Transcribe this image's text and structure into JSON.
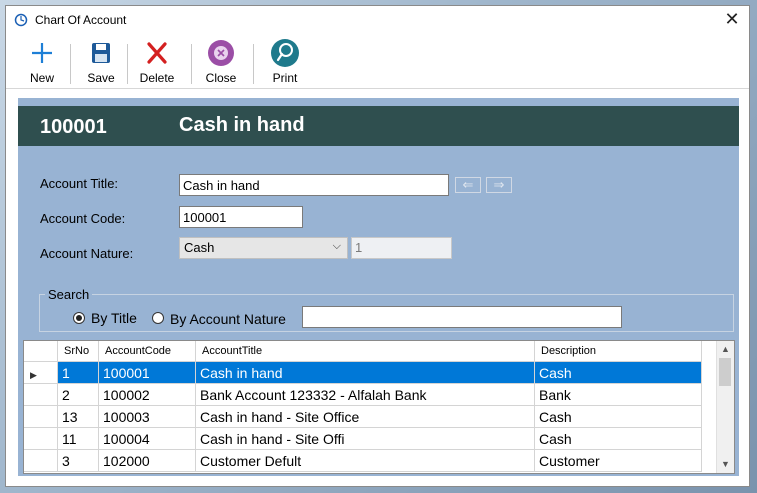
{
  "window": {
    "title": "Chart Of Account"
  },
  "toolbar": {
    "new_label": "New",
    "save_label": "Save",
    "delete_label": "Delete",
    "close_label": "Close",
    "print_label": "Print"
  },
  "header": {
    "code": "100001",
    "name": "Cash in hand"
  },
  "form": {
    "account_title_label": "Account Title:",
    "account_title_value": "Cash in hand",
    "account_code_label": "Account Code:",
    "account_code_value": "100001",
    "account_nature_label": "Account Nature:",
    "account_nature_value": "Cash",
    "nature_id_value": "1"
  },
  "search": {
    "group_label": "Search",
    "by_title_label": "By Title",
    "by_nature_label": "By Account Nature",
    "selected": "by_title",
    "query_value": ""
  },
  "grid": {
    "columns": [
      "SrNo",
      "AccountCode",
      "AccountTitle",
      "Description"
    ],
    "rows": [
      {
        "srno": "1",
        "code": "100001",
        "title": "Cash in hand",
        "desc": "Cash"
      },
      {
        "srno": "2",
        "code": "100002",
        "title": "Bank Account 123332 - Alfalah Bank",
        "desc": "Bank"
      },
      {
        "srno": "13",
        "code": "100003",
        "title": "Cash in hand - Site Office",
        "desc": "Cash"
      },
      {
        "srno": "11",
        "code": "100004",
        "title": "Cash in hand - Site Offi",
        "desc": "Cash"
      },
      {
        "srno": "3",
        "code": "102000",
        "title": "Customer Defult",
        "desc": "Customer"
      }
    ],
    "selected_index": 0
  },
  "colors": {
    "header_bg": "#2f4f4f",
    "panel_bg": "#98b3d3",
    "selection": "#0078d7"
  }
}
